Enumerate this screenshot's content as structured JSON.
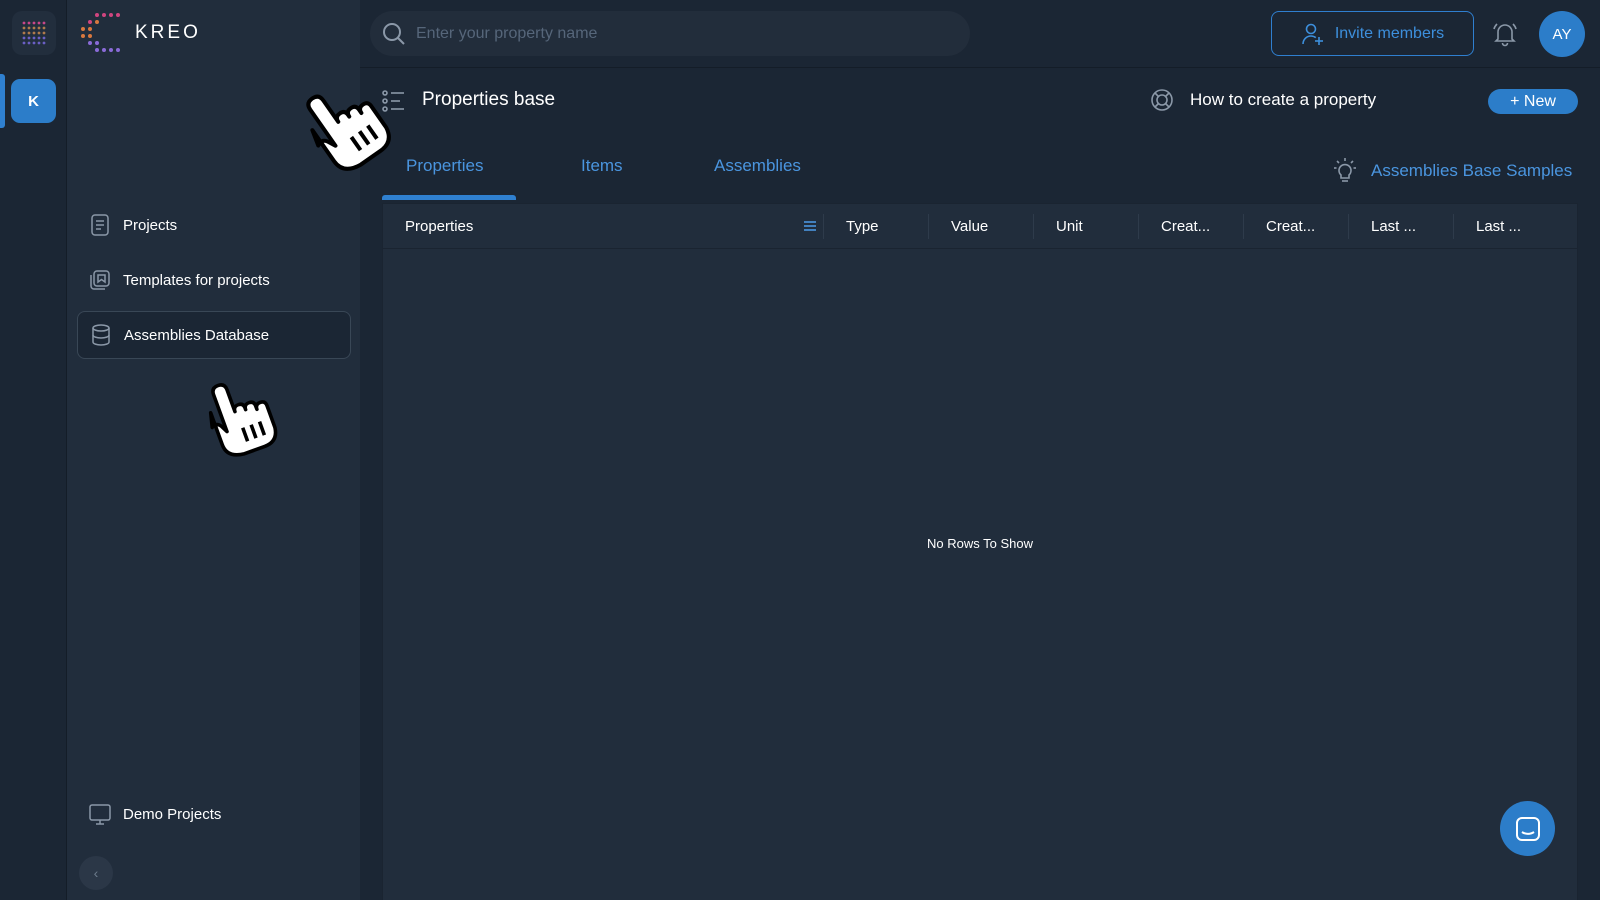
{
  "brand": {
    "name": "KREO"
  },
  "rail": {
    "workspace_initial": "K"
  },
  "sidebar": {
    "items": [
      {
        "label": "Projects",
        "icon": "projects-icon"
      },
      {
        "label": "Templates for projects",
        "icon": "templates-icon"
      },
      {
        "label": "Assemblies Database",
        "icon": "database-icon",
        "active": true
      }
    ],
    "footer_item": {
      "label": "Demo Projects",
      "icon": "monitor-icon"
    }
  },
  "topbar": {
    "search_placeholder": "Enter your property name",
    "invite_label": "Invite members",
    "avatar_initials": "AY"
  },
  "main": {
    "title": "Properties base",
    "help_label": "How to create a property",
    "new_label": "+ New",
    "samples_label": "Assemblies Base Samples",
    "tabs": [
      {
        "label": "Properties",
        "active": true
      },
      {
        "label": "Items"
      },
      {
        "label": "Assemblies"
      }
    ],
    "columns": [
      "Properties",
      "Type",
      "Value",
      "Unit",
      "Creat...",
      "Creat...",
      "Last ...",
      "Last ..."
    ],
    "empty_text": "No Rows To Show"
  },
  "colors": {
    "accent": "#2c7dc9",
    "link": "#4a95df",
    "background": "#1b2634",
    "panel": "#212d3c"
  }
}
